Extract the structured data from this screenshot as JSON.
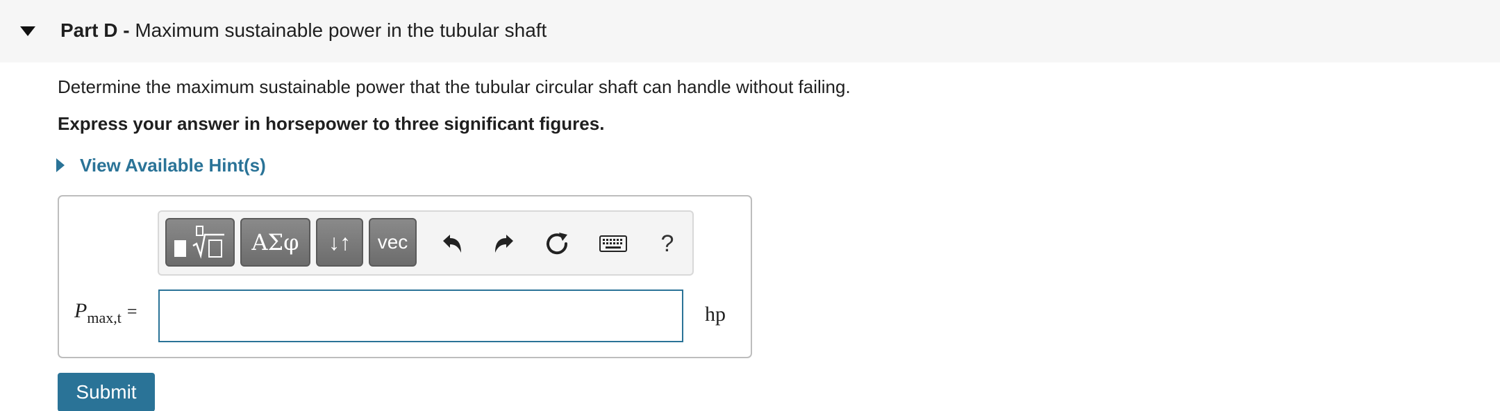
{
  "part": {
    "label": "Part D -",
    "title": "Maximum sustainable power in the tubular shaft"
  },
  "question": {
    "prompt": "Determine the maximum sustainable power that the tubular circular shaft can handle without failing.",
    "instruction": "Express your answer in horsepower to three significant figures."
  },
  "hint": {
    "label": "View Available Hint(s)"
  },
  "toolbar": {
    "greek_label": "ΑΣφ",
    "subsup_label": "↓↑",
    "vec_label": "vec",
    "help_label": "?"
  },
  "answer": {
    "variable": "P",
    "subscript": "max,t",
    "equals": "=",
    "value": "",
    "unit": "hp"
  },
  "submit": {
    "label": "Submit"
  },
  "colors": {
    "accent": "#2a7397",
    "header_bg": "#f6f6f6",
    "toolbar_button": "#7a7a7a"
  }
}
